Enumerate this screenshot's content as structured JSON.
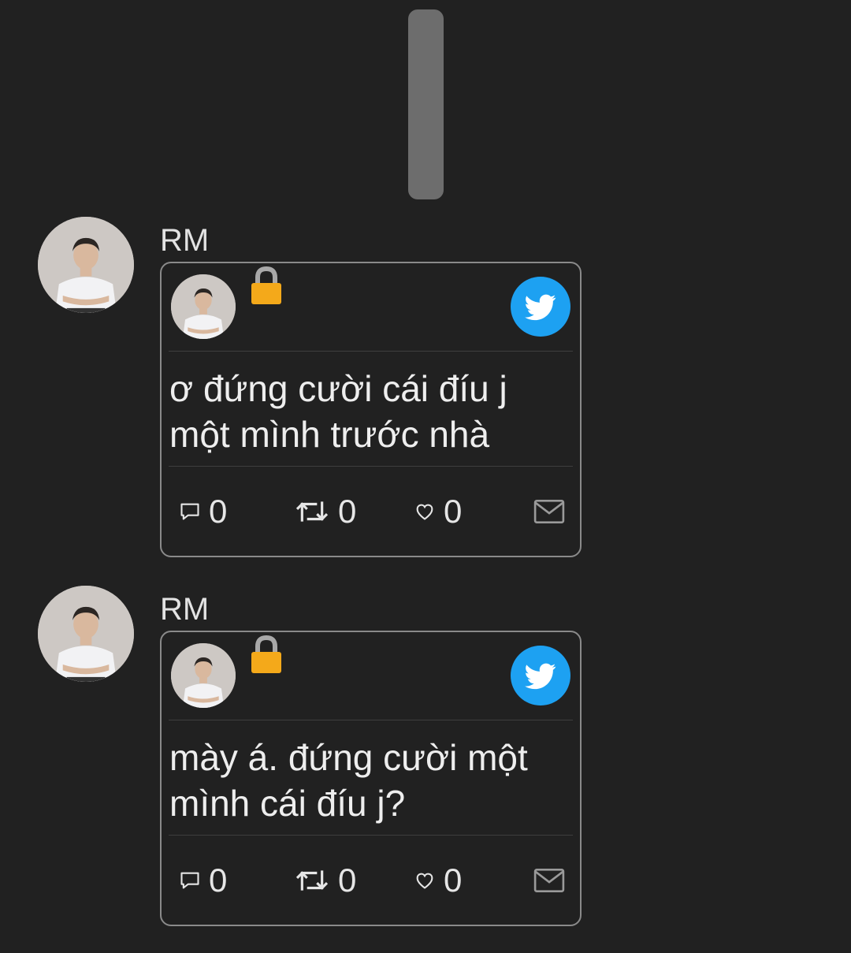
{
  "colors": {
    "background": "#212121",
    "card_border": "#8a8a8a",
    "twitter_blue": "#1da1f2",
    "lock_gold": "#f4a91a"
  },
  "messages": [
    {
      "sender": "RM",
      "tweet": {
        "locked_icon": "lock-icon",
        "badge_icon": "twitter-bird-icon",
        "text_line1": "ơ đứng cười cái đíu j",
        "text_line2": "một mình trước nhà",
        "reply_count": "0",
        "retweet_count": "0",
        "like_count": "0"
      }
    },
    {
      "sender": "RM",
      "tweet": {
        "locked_icon": "lock-icon",
        "badge_icon": "twitter-bird-icon",
        "text_line1": "mày á. đứng cười một",
        "text_line2": "mình cái đíu j?",
        "reply_count": "0",
        "retweet_count": "0",
        "like_count": "0"
      }
    }
  ]
}
